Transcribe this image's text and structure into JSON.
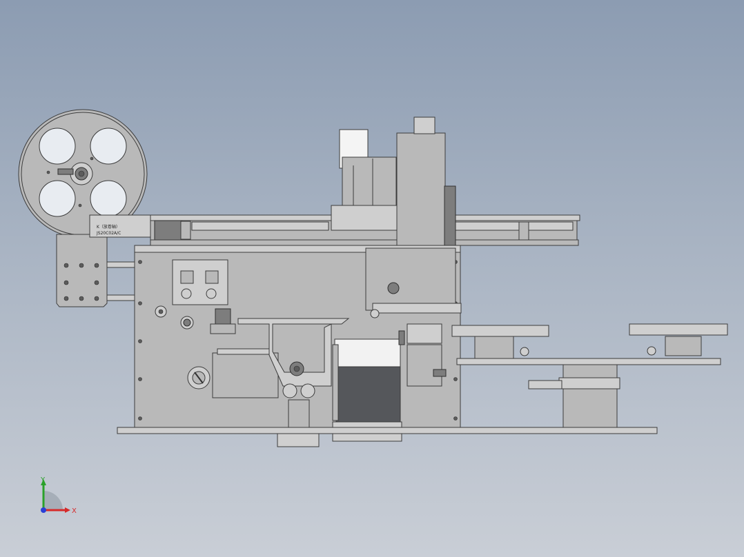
{
  "labels": {
    "plate_line_1": "K（放卷轴）",
    "plate_line_2": "JS20C02A/C"
  },
  "triad": {
    "x_label": "X",
    "y_label": "Y",
    "x_color": "#d62a2a",
    "y_color": "#2aa12a",
    "z_color": "#2a3fd6"
  },
  "colors": {
    "background_top": "#8c9cb2",
    "background_bottom": "#c9ced6",
    "metal": "#b9b9b9",
    "metal_light": "#cfcfcf",
    "metal_dark": "#7d7d7d",
    "edge": "#3b3b3b"
  }
}
